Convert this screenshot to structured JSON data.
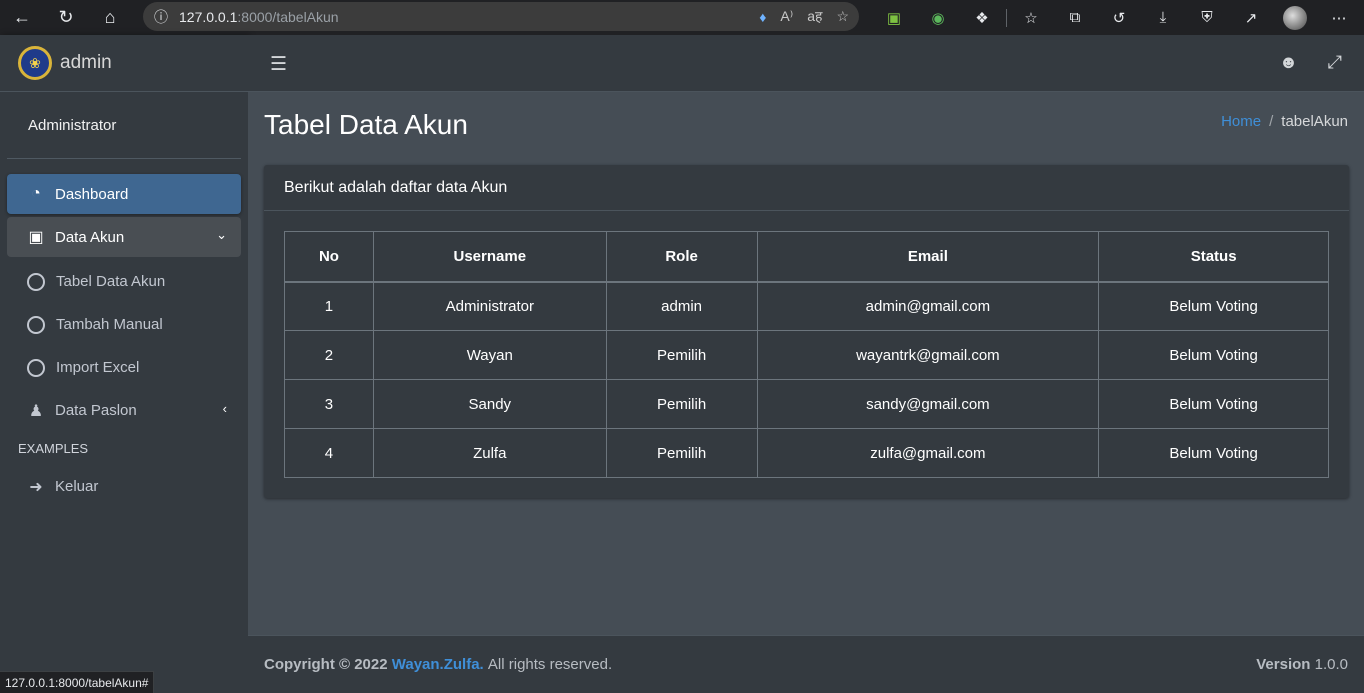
{
  "browser": {
    "url_host": "127.0.0.1",
    "url_rest": ":8000/tabelAkun",
    "status_url": "127.0.0.1:8000/tabelAkun#"
  },
  "sidebar": {
    "brand": "admin",
    "user": "Administrator",
    "items": [
      {
        "label": "Dashboard"
      },
      {
        "label": "Data Akun"
      },
      {
        "label": "Tabel Data Akun"
      },
      {
        "label": "Tambah Manual"
      },
      {
        "label": "Import Excel"
      },
      {
        "label": "Data Paslon"
      }
    ],
    "section_header": "EXAMPLES",
    "logout": "Keluar"
  },
  "page": {
    "title": "Tabel Data Akun",
    "breadcrumb_home": "Home",
    "breadcrumb_sep": "/",
    "breadcrumb_current": "tabelAkun",
    "card_title": "Berikut adalah daftar data Akun"
  },
  "table": {
    "headers": [
      "No",
      "Username",
      "Role",
      "Email",
      "Status"
    ],
    "rows": [
      [
        "1",
        "Administrator",
        "admin",
        "admin@gmail.com",
        "Belum Voting"
      ],
      [
        "2",
        "Wayan",
        "Pemilih",
        "wayantrk@gmail.com",
        "Belum Voting"
      ],
      [
        "3",
        "Sandy",
        "Pemilih",
        "sandy@gmail.com",
        "Belum Voting"
      ],
      [
        "4",
        "Zulfa",
        "Pemilih",
        "zulfa@gmail.com",
        "Belum Voting"
      ]
    ]
  },
  "footer": {
    "copyright": "Copyright © 2022",
    "author": "Wayan.Zulfa.",
    "rights": "All rights reserved.",
    "version_label": "Version",
    "version_value": "1.0.0"
  },
  "colors": {
    "accent": "#3f6791",
    "link": "#3f8fd8",
    "sidebar_bg": "#343a40",
    "content_bg": "#454d55"
  }
}
